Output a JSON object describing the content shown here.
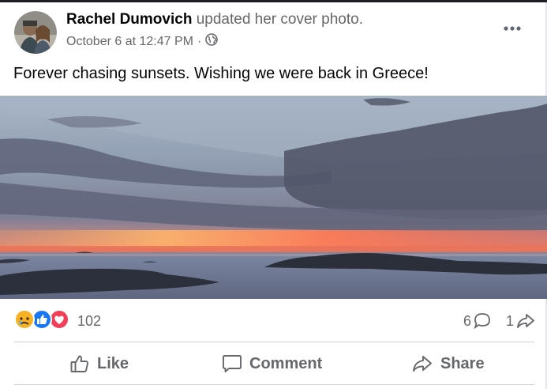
{
  "post": {
    "author": "Rachel Dumovich",
    "action": " updated her cover photo.",
    "timestamp": "October 6 at 12:47 PM",
    "dot": "·",
    "caption": "Forever chasing sunsets. Wishing we were back in Greece!"
  },
  "reactions": {
    "icons": [
      "sad-icon",
      "like-icon",
      "love-icon"
    ],
    "count": "102"
  },
  "stats": {
    "comments": "6",
    "shares": "1"
  },
  "actions": {
    "like": "Like",
    "comment": "Comment",
    "share": "Share"
  },
  "colors": {
    "like_blue": "#1877f2",
    "love_red": "#f33e58",
    "sad_yellow": "#f7b125",
    "secondary_text": "#65676b"
  }
}
